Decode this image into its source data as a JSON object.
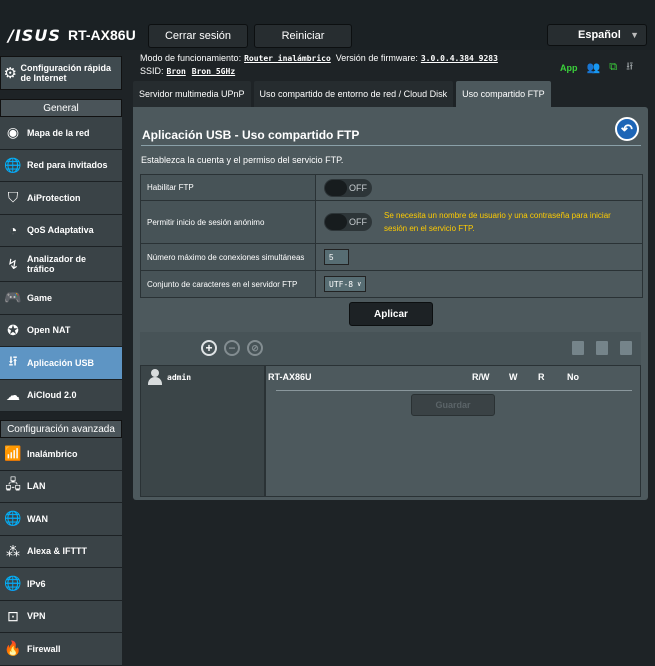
{
  "header": {
    "brand": "/ISUS",
    "model": "RT-AX86U",
    "logout_label": "Cerrar sesión",
    "reboot_label": "Reiniciar",
    "language": "Español",
    "mode_label": "Modo de funcionamiento:",
    "mode_value": "Router inalámbrico",
    "firmware_label": "Versión de firmware:",
    "firmware_value": "3.0.0.4.384_9283",
    "ssid_label": "SSID:",
    "ssid_1": "Bron",
    "ssid_2": "Bron_5GHz",
    "app_label": "App"
  },
  "sidebar": {
    "quick_setup": "Configuración rápida de Internet",
    "general_header": "General",
    "general_items": [
      {
        "label": "Mapa de la red",
        "icon": "network-map-icon"
      },
      {
        "label": "Red para invitados",
        "icon": "guest-network-icon"
      },
      {
        "label": "AiProtection",
        "icon": "shield-icon"
      },
      {
        "label": "QoS Adaptativa",
        "icon": "speedometer-icon"
      },
      {
        "label": "Analizador de tráfico",
        "icon": "traffic-analyzer-icon"
      },
      {
        "label": "Game",
        "icon": "gamepad-icon"
      },
      {
        "label": "Open NAT",
        "icon": "open-nat-icon"
      },
      {
        "label": "Aplicación USB",
        "icon": "usb-icon"
      },
      {
        "label": "AiCloud 2.0",
        "icon": "cloud-icon"
      }
    ],
    "advanced_header": "Configuración avanzada",
    "advanced_items": [
      {
        "label": "Inalámbrico",
        "icon": "wifi-icon"
      },
      {
        "label": "LAN",
        "icon": "lan-icon"
      },
      {
        "label": "WAN",
        "icon": "globe-icon"
      },
      {
        "label": "Alexa & IFTTT",
        "icon": "alexa-icon"
      },
      {
        "label": "IPv6",
        "icon": "ipv6-icon"
      },
      {
        "label": "VPN",
        "icon": "vpn-icon"
      },
      {
        "label": "Firewall",
        "icon": "firewall-icon"
      }
    ]
  },
  "tabs": [
    {
      "label": "Servidor multimedia UPnP"
    },
    {
      "label": "Uso compartido de entorno de red / Cloud Disk"
    },
    {
      "label": "Uso compartido FTP"
    }
  ],
  "content": {
    "title": "Aplicación USB - Uso compartido FTP",
    "description": "Establezca la cuenta y el permiso del servicio FTP.",
    "enable_ftp_label": "Habilitar FTP",
    "enable_ftp_state": "OFF",
    "anon_label": "Permitir inicio de sesión anónimo",
    "anon_state": "OFF",
    "anon_warning": "Se necesita un nombre de usuario y una contraseña para iniciar sesión en el servicio FTP.",
    "max_conn_label": "Número máximo de conexiones simultáneas",
    "max_conn_value": "5",
    "charset_label": "Conjunto de caracteres en el servidor FTP",
    "charset_value": "UTF-8",
    "apply_label": "Aplicar"
  },
  "accounts": {
    "users": [
      "admin"
    ],
    "device": "RT-AX86U",
    "perm_headers": [
      "R/W",
      "W",
      "R",
      "No"
    ],
    "save_label": "Guardar"
  },
  "colors": {
    "active_menu": "#5e95c4",
    "warning_text": "#ffcc00",
    "panel": "#4d595d",
    "back_button": "#1d65b6"
  }
}
